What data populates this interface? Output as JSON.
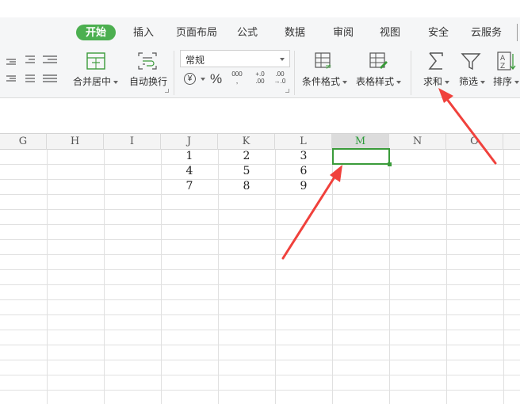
{
  "tabs": [
    {
      "label": "开始",
      "active": true
    },
    {
      "label": "插入"
    },
    {
      "label": "页面布局"
    },
    {
      "label": "公式"
    },
    {
      "label": "数据"
    },
    {
      "label": "审阅"
    },
    {
      "label": "视图"
    },
    {
      "label": "安全"
    },
    {
      "label": "云服务"
    }
  ],
  "ribbon": {
    "merge_center": "合并居中",
    "auto_wrap": "自动换行",
    "number_format": "常规",
    "currency_symbol": "¥",
    "percent_symbol": "%",
    "thousands_symbol": "000",
    "inc_decimal": "+.0 .00",
    "dec_decimal": ".00 →.0",
    "conditional_format": "条件格式",
    "table_style": "表格样式",
    "sum": "求和",
    "filter": "筛选",
    "sort": "排序"
  },
  "sheet": {
    "columns": [
      "G",
      "H",
      "I",
      "J",
      "K",
      "L",
      "M",
      "N",
      "O"
    ],
    "selected_column": "M",
    "rows": [
      [
        "",
        "",
        "",
        "1",
        "2",
        "3",
        "",
        "",
        ""
      ],
      [
        "",
        "",
        "",
        "4",
        "5",
        "6",
        "",
        "",
        ""
      ],
      [
        "",
        "",
        "",
        "7",
        "8",
        "9",
        "",
        "",
        ""
      ]
    ]
  },
  "colors": {
    "accent_green": "#4caf50",
    "selection_green": "#3a9b3a",
    "arrow_red": "#f0413c"
  }
}
